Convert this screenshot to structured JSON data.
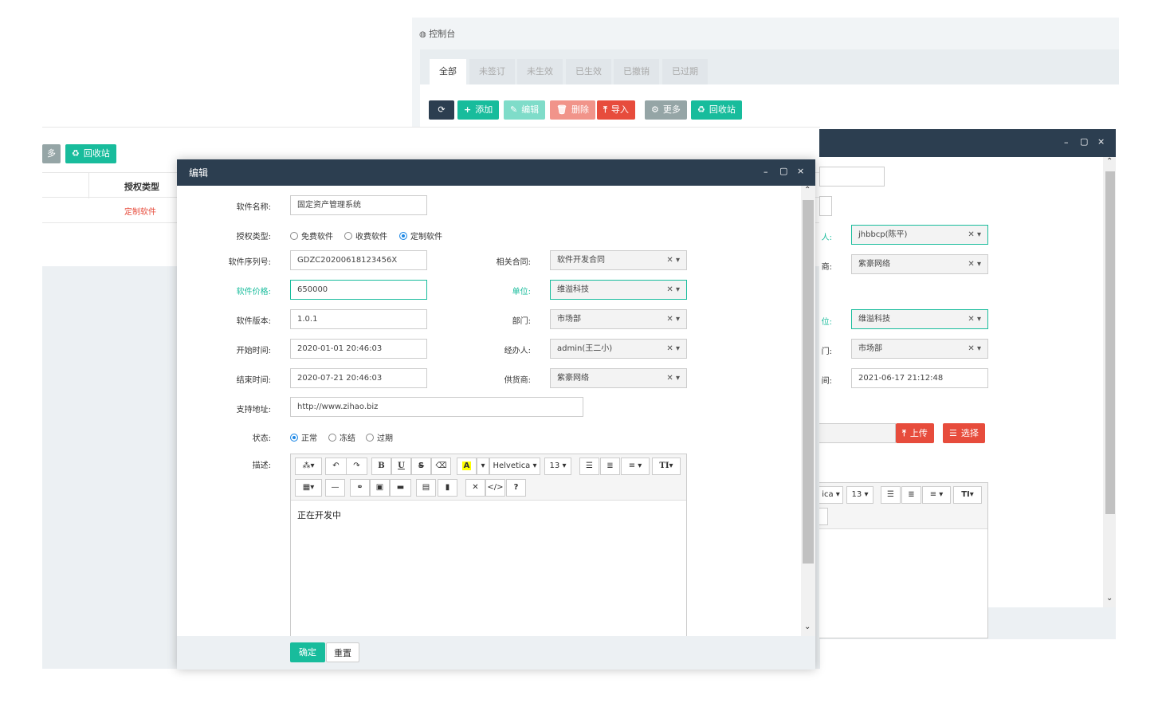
{
  "console": {
    "title": "控制台",
    "tabs": [
      "全部",
      "未签订",
      "未生效",
      "已生效",
      "已撤销",
      "已过期"
    ],
    "toolbar": {
      "refresh": "",
      "add": "添加",
      "edit": "编辑",
      "delete": "删除",
      "import": "导入",
      "more": "更多",
      "recycle": "回收站"
    }
  },
  "list": {
    "more": "多",
    "recycle": "回收站",
    "column_auth_type": "授权类型",
    "row_auth_type": "定制软件"
  },
  "right_modal": {
    "handler_label": "人:",
    "handler_value": "jhbbcp(陈平)",
    "supplier_label": "商:",
    "supplier_value": "紫豪网络",
    "unit_label": "位:",
    "unit_value": "维溢科技",
    "dept_label": "门:",
    "dept_value": "市场部",
    "time_label": "间:",
    "time_value": "2021-06-17 21:12:48",
    "upload": "上传",
    "choose": "选择",
    "font_fragment": "ica",
    "font_size": "13"
  },
  "modal": {
    "title": "编辑",
    "fields": {
      "software_name_label": "软件名称:",
      "software_name_value": "固定资产管理系统",
      "auth_type_label": "授权类型:",
      "auth_options": [
        "免费软件",
        "收费软件",
        "定制软件"
      ],
      "serial_label": "软件序列号:",
      "serial_value": "GDZC20200618123456X",
      "contract_label": "相关合同:",
      "contract_value": "软件开发合同",
      "price_label": "软件价格:",
      "price_value": "650000",
      "unit_label": "单位:",
      "unit_value": "维溢科技",
      "version_label": "软件版本:",
      "version_value": "1.0.1",
      "dept_label": "部门:",
      "dept_value": "市场部",
      "start_label": "开始时间:",
      "start_value": "2020-01-01 20:46:03",
      "handler_label": "经办人:",
      "handler_value": "admin(王二小)",
      "end_label": "结束时间:",
      "end_value": "2020-07-21 20:46:03",
      "supplier_label": "供货商:",
      "supplier_value": "紫豪网络",
      "support_label": "支持地址:",
      "support_value": "http://www.zihao.biz",
      "status_label": "状态:",
      "status_options": [
        "正常",
        "冻结",
        "过期"
      ],
      "desc_label": "描述:"
    },
    "editor": {
      "font": "Helvetica",
      "size": "13",
      "content": "正在开发中"
    },
    "buttons": {
      "ok": "确定",
      "reset": "重置"
    }
  },
  "colors": {
    "header": "#2c3e50",
    "primary": "#18bc9c",
    "danger": "#e74c3c",
    "dark": "#2c3e50",
    "gray": "#95a5a6"
  }
}
